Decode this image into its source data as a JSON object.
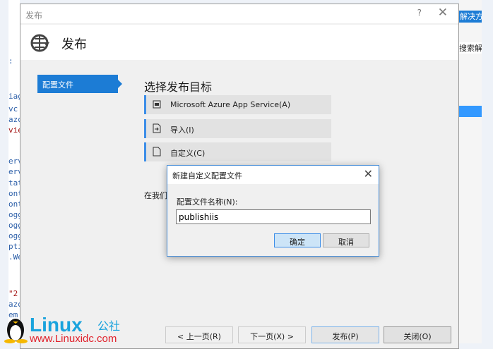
{
  "background_code": {
    "lines": [
      ": '",
      "iag",
      "vc'",
      "azo",
      "vie",
      "erv",
      "erv",
      "tat",
      "ont",
      "ont",
      "ogg",
      "ogg",
      "ogg",
      "pti",
      ".We",
      "\"2",
      "azo",
      "em"
    ]
  },
  "solution_explorer": {
    "title": "解决方",
    "search": "搜索解"
  },
  "window": {
    "title": "发布",
    "help": "?",
    "close": "✕"
  },
  "header": {
    "title": "发布",
    "icon": "globe-publish-icon"
  },
  "nav": {
    "items": [
      {
        "label": "配置文件"
      }
    ]
  },
  "main": {
    "heading": "选择发布目标",
    "options": [
      {
        "label": "Microsoft Azure App Service(A)",
        "icon": "cloud-server-icon"
      },
      {
        "label": "导入(I)",
        "icon": "import-icon"
      },
      {
        "label": "自定义(C)",
        "icon": "document-icon"
      }
    ],
    "hint": "在我们"
  },
  "footer": {
    "prev": "< 上一页(R)",
    "next": "下一页(X) >",
    "publish": "发布(P)",
    "close": "关闭(O)"
  },
  "modal": {
    "title": "新建自定义配置文件",
    "label": "配置文件名称(N):",
    "value": "publishiis",
    "ok": "确定",
    "cancel": "取消"
  },
  "watermark": {
    "brand": "Linux公社",
    "url": "www.Linuxidc.com"
  }
}
